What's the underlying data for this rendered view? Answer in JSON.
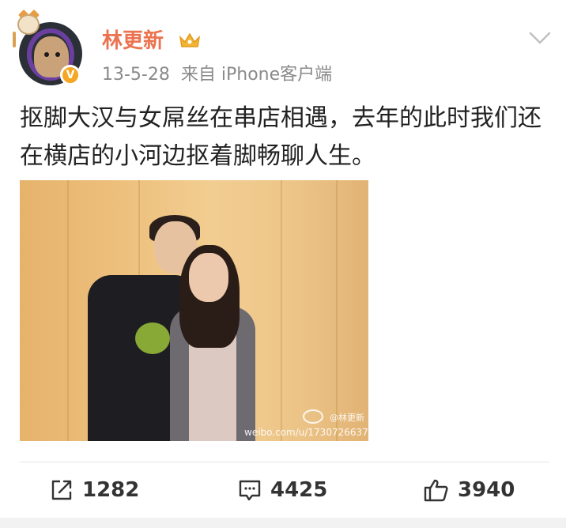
{
  "post": {
    "username": "林更新",
    "date": "13-5-28",
    "source": "来自 iPhone客户端",
    "text": "抠脚大汉与女屌丝在串店相遇，去年的此时我们还在横店的小河边抠着脚畅聊人生。",
    "watermark_name": "@林更新",
    "watermark_url": "weibo.com/u/1730726637"
  },
  "actions": {
    "repost_count": "1282",
    "comment_count": "4425",
    "like_count": "3940"
  },
  "icons": {
    "verified": "verified-badge-icon",
    "crown": "crown-icon",
    "menu": "chevron-down-icon",
    "repost": "repost-icon",
    "comment": "comment-icon",
    "like": "thumbs-up-icon"
  },
  "colors": {
    "username": "#eb7350",
    "meta": "#8a8a8a",
    "text": "#222222",
    "verified": "#f5a623"
  }
}
